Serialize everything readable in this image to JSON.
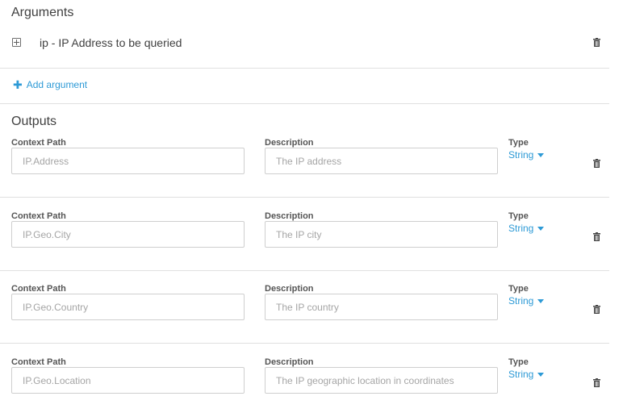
{
  "arguments": {
    "title": "Arguments",
    "items": [
      {
        "label": "ip - IP Address to be queried"
      }
    ],
    "add_label": "Add argument"
  },
  "outputs": {
    "title": "Outputs",
    "labels": {
      "context_path": "Context Path",
      "description": "Description",
      "type": "Type"
    },
    "items": [
      {
        "context_path": "IP.Address",
        "description": "The IP address",
        "type": "String"
      },
      {
        "context_path": "IP.Geo.City",
        "description": "The IP city",
        "type": "String"
      },
      {
        "context_path": "IP.Geo.Country",
        "description": "The IP country",
        "type": "String"
      },
      {
        "context_path": "IP.Geo.Location",
        "description": "The IP geographic location in coordinates",
        "type": "String"
      }
    ]
  },
  "colors": {
    "accent": "#2d9ad6",
    "border": "#cfcfcf",
    "divider": "#e0e0e0"
  }
}
